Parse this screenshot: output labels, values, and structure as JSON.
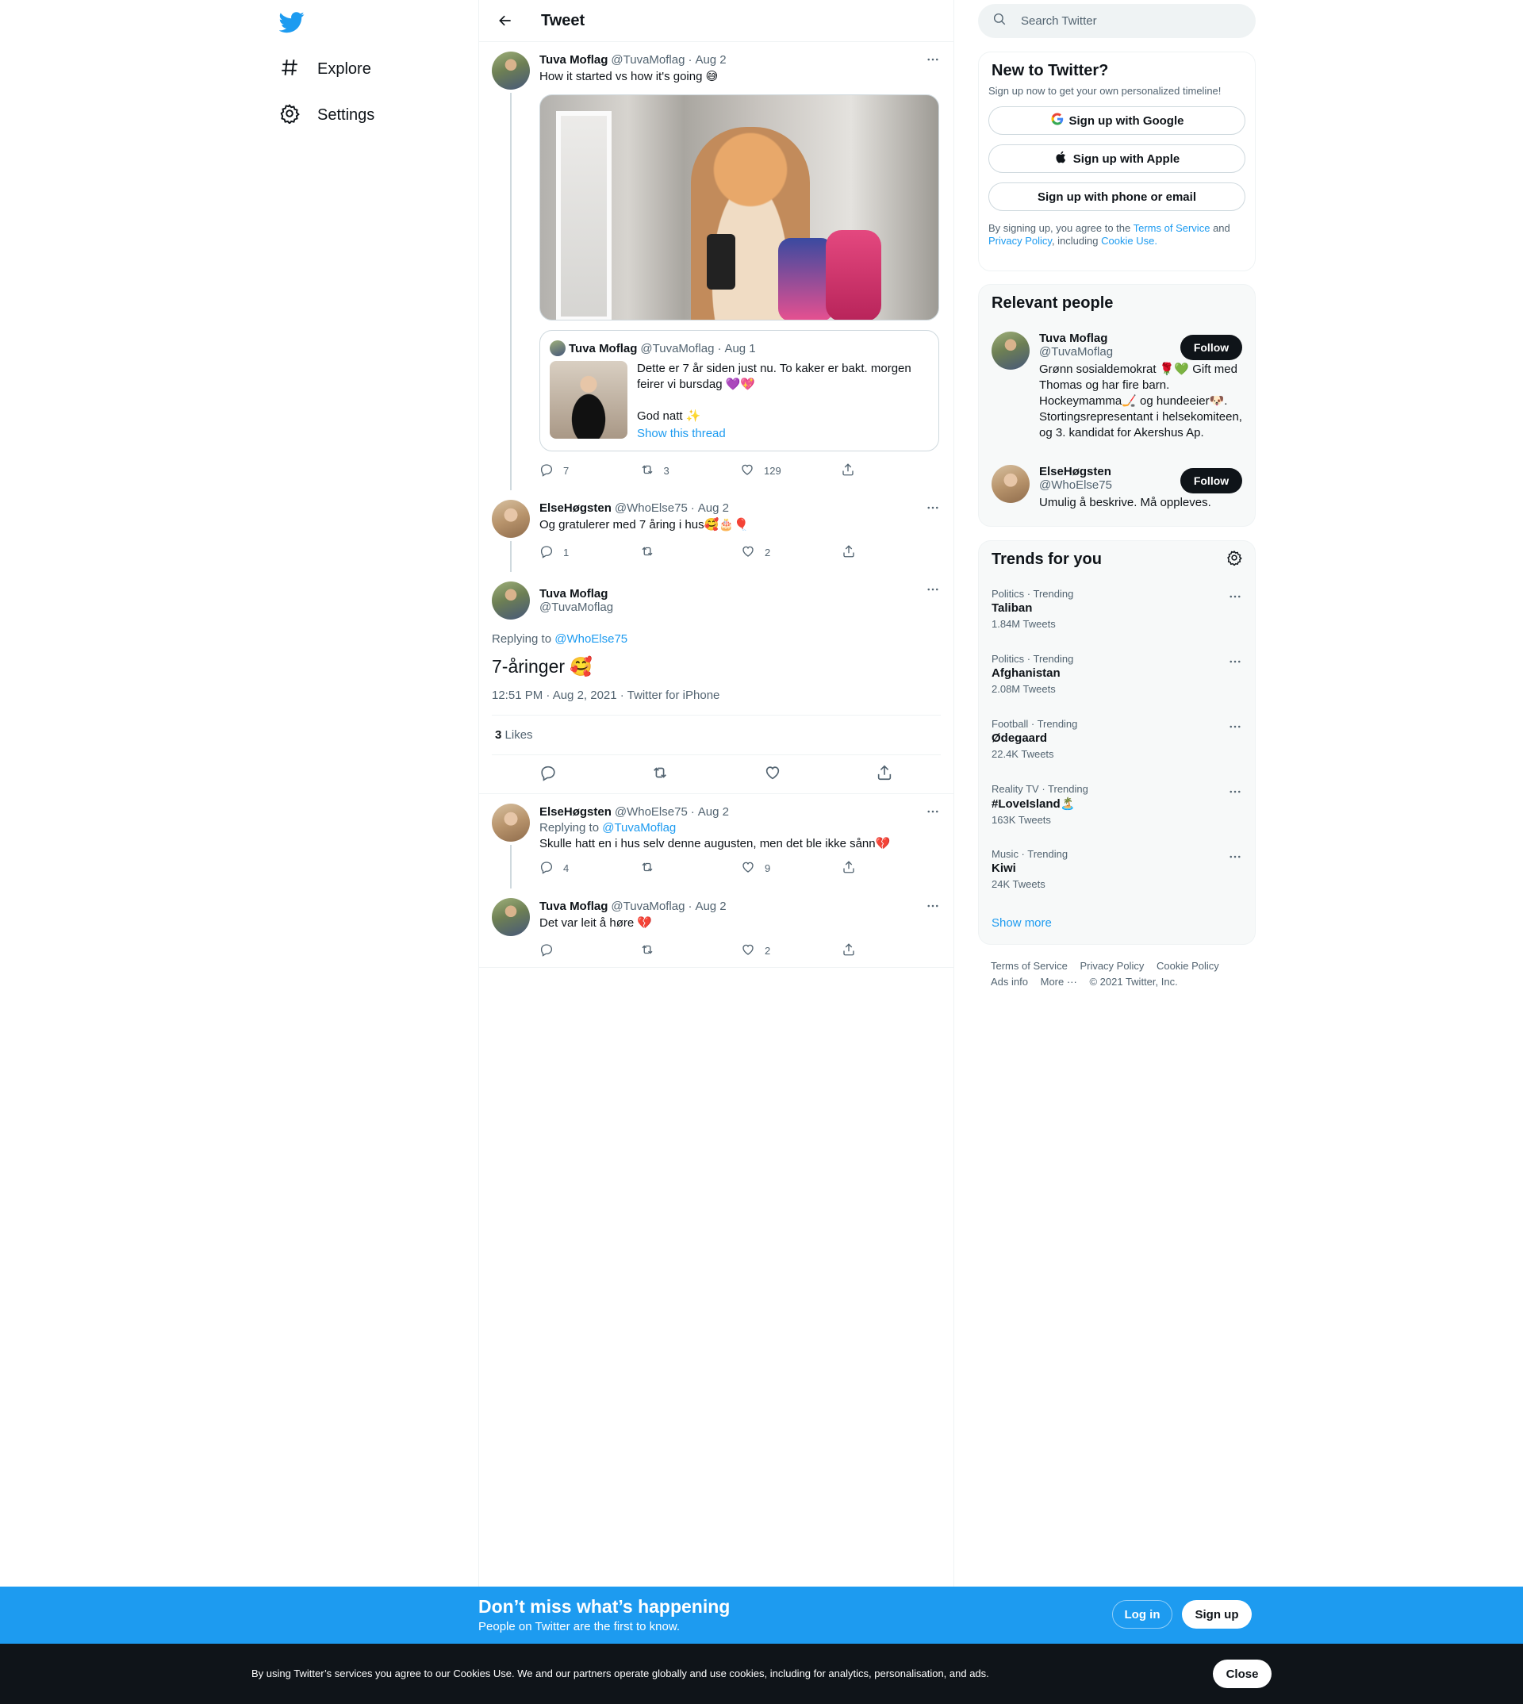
{
  "nav": {
    "items": [
      {
        "label": "Explore",
        "icon": "hashtag-icon"
      },
      {
        "label": "Settings",
        "icon": "gear-icon"
      }
    ],
    "brand_color": "#1d9bf0"
  },
  "header": {
    "title": "Tweet"
  },
  "thread": {
    "t1": {
      "name": "Tuva Moflag",
      "handle": "@TuvaMoflag",
      "dot": "·",
      "date": "Aug 2",
      "text": "How it started vs how it's going 😅",
      "quote": {
        "name": "Tuva Moflag",
        "handle": "@TuvaMoflag",
        "dot": "·",
        "date": "Aug 1",
        "line1": "Dette er 7 år siden just nu. To kaker er bakt. morgen feirer vi bursdag 💜💖",
        "line2": "God natt ✨",
        "show_thread": "Show this thread"
      },
      "replies": "7",
      "retweets": "3",
      "likes": "129"
    },
    "t2": {
      "name": "ElseHøgsten",
      "handle": "@WhoElse75",
      "dot": "·",
      "date": "Aug 2",
      "text": "Og gratulerer med 7 åring i hus🥰🎂🎈",
      "replies": "1",
      "retweets": "",
      "likes": "2"
    },
    "focal": {
      "name": "Tuva Moflag",
      "handle": "@TuvaMoflag",
      "replying_prefix": "Replying to",
      "replying_to": "@WhoElse75",
      "text": "7-åringer 🥰",
      "meta": "12:51 PM · Aug 2, 2021 · Twitter for iPhone",
      "likes_count": "3",
      "likes_label": "Likes"
    },
    "r1": {
      "name": "ElseHøgsten",
      "handle": "@WhoElse75",
      "dot": "·",
      "date": "Aug 2",
      "replying_prefix": "Replying to",
      "replying_to": "@TuvaMoflag",
      "text": "Skulle hatt en i hus selv denne augusten, men det ble ikke sånn💔",
      "replies": "4",
      "retweets": "",
      "likes": "9"
    },
    "r2": {
      "name": "Tuva Moflag",
      "handle": "@TuvaMoflag",
      "dot": "·",
      "date": "Aug 2",
      "text": "Det var leit å høre 💔",
      "replies": "",
      "retweets": "",
      "likes": "2"
    }
  },
  "search": {
    "placeholder": "Search Twitter"
  },
  "new_to_twitter": {
    "title": "New to Twitter?",
    "sub": "Sign up now to get your own personalized timeline!",
    "google": "Sign up with Google",
    "apple": "Sign up with Apple",
    "phone": "Sign up with phone or email",
    "legal_1": "By signing up, you agree to the",
    "terms": "Terms of Service",
    "legal_2": "and",
    "privacy": "Privacy Policy",
    "legal_3": ", including",
    "cookie": "Cookie Use."
  },
  "relevant": {
    "title": "Relevant people",
    "people": [
      {
        "name": "Tuva Moflag",
        "handle": "@TuvaMoflag",
        "bio": "Grønn sosialdemokrat 🌹💚 Gift med Thomas og har fire barn. Hockeymamma🏒 og hundeeier🐶. Stortingsrepresentant i helsekomiteen, og 3. kandidat for Akershus Ap.",
        "follow": "Follow"
      },
      {
        "name": "ElseHøgsten",
        "handle": "@WhoElse75",
        "bio": "Umulig å beskrive. Må oppleves.",
        "follow": "Follow"
      }
    ]
  },
  "trends": {
    "title": "Trends for you",
    "items": [
      {
        "context": "Politics · Trending",
        "title": "Taliban",
        "count": "1.84M Tweets"
      },
      {
        "context": "Politics · Trending",
        "title": "Afghanistan",
        "count": "2.08M Tweets"
      },
      {
        "context": "Football · Trending",
        "title": "Ødegaard",
        "count": "22.4K Tweets"
      },
      {
        "context": "Reality TV · Trending",
        "title": "#LoveIsland🏝️",
        "count": "163K Tweets"
      },
      {
        "context": "Music · Trending",
        "title": "Kiwi",
        "count": "24K Tweets"
      }
    ],
    "show_more": "Show more"
  },
  "footer": {
    "terms": "Terms of Service",
    "privacy": "Privacy Policy",
    "cookie": "Cookie Policy",
    "ads": "Ads info",
    "more": "More ···",
    "copyright": "© 2021 Twitter, Inc."
  },
  "banner": {
    "title": "Don’t miss what’s happening",
    "sub": "People on Twitter are the first to know.",
    "login": "Log in",
    "signup": "Sign up"
  },
  "cookie_bar": {
    "text": "By using Twitter’s services you agree to our Cookies Use. We and our partners operate globally and use cookies, including for analytics, personalisation, and ads.",
    "close": "Close"
  }
}
